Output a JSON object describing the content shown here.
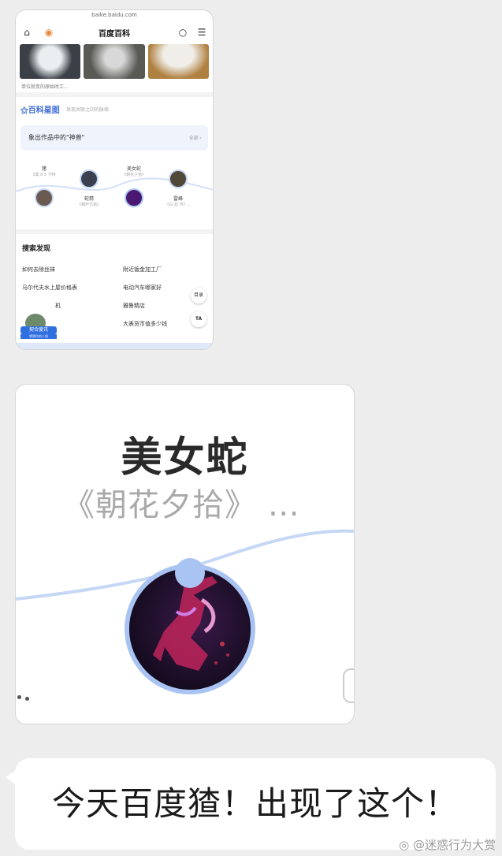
{
  "screenshot_small": {
    "url": "baike.baidu.com",
    "title": "百度百科",
    "thumb_caption": "单位就变的原始时工...",
    "graph_title": "百科星图",
    "graph_subtitle": "发现关联之间的脉络",
    "topic": "象出作品中的\"神兽\"",
    "topic_more": "全部 ›",
    "nodes": [
      {
        "name": "猪",
        "sub": "3集 8.5 卡特"
      },
      {
        "name": "蛇精",
        "sub": "《葫芦兄弟》"
      },
      {
        "name": "美女蛇",
        "sub": "《朝花夕拾》"
      },
      {
        "name": "雷峰",
        "sub": "《白 蛇 传》..."
      }
    ],
    "discover_title": "搜索发现",
    "discover_items": [
      "如何去除丝袜",
      "附近钣金加工厂",
      "马尔代夫水上屋价格表",
      "电动汽车哪家好",
      "机",
      "雅鲁精店",
      "",
      "大表货币值多少钱"
    ],
    "fab_catalog": "目录",
    "fab_ta": "TA",
    "badge_label": "契合度讯",
    "badge_sub": "猜猜你的人格"
  },
  "screenshot_zoom": {
    "name": "美女蛇",
    "work": "《朝花夕拾》 …"
  },
  "message": {
    "text": "今天百度猹！出现了这个！"
  },
  "watermark": "@迷惑行为大赏",
  "colors": {
    "accent_blue": "#3c6bd9",
    "node_blue": "#a9c4f2",
    "background": "#ededed"
  }
}
